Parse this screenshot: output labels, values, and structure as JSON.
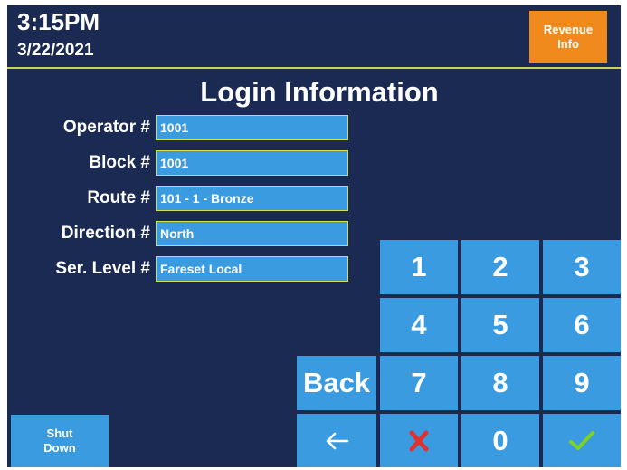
{
  "header": {
    "time": "3:15PM",
    "date": "3/22/2021",
    "revenue_button": "Revenue\nInfo"
  },
  "title": "Login Information",
  "fields": [
    {
      "label": "Operator #",
      "value": "1001"
    },
    {
      "label": "Block #",
      "value": "1001"
    },
    {
      "label": "Route #",
      "value": "101 - 1 - Bronze"
    },
    {
      "label": "Direction #",
      "value": "North"
    },
    {
      "label": "Ser. Level #",
      "value": "Fareset Local"
    }
  ],
  "keypad": {
    "digits": [
      "1",
      "2",
      "3",
      "4",
      "5",
      "6",
      "7",
      "8",
      "9",
      "0"
    ],
    "back": "Back",
    "backspace_icon": "left-arrow-icon",
    "clear_icon": "red-x-icon",
    "enter_icon": "green-check-icon"
  },
  "shutdown_button": "Shut\nDown",
  "colors": {
    "background": "#1a2a52",
    "key": "#3a9be0",
    "accent_orange": "#f08a1d",
    "field_border": "#d8db4e",
    "clear_red": "#e03030",
    "enter_green": "#7ed321"
  }
}
